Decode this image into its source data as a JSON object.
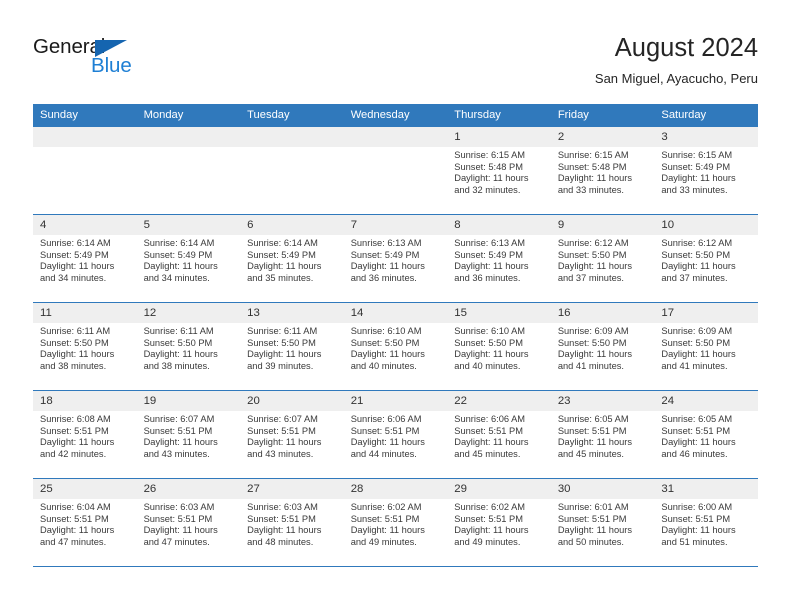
{
  "brand": {
    "name_part1": "General",
    "name_part2": "Blue",
    "accent_color": "#1e7fd4",
    "triangle_color": "#1565b0"
  },
  "header": {
    "title": "August 2024",
    "subtitle": "San Miguel, Ayacucho, Peru"
  },
  "theme": {
    "header_bg": "#3079bc",
    "daynum_bg": "#efefef",
    "border": "#3079bc"
  },
  "weekday_headers": [
    "Sunday",
    "Monday",
    "Tuesday",
    "Wednesday",
    "Thursday",
    "Friday",
    "Saturday"
  ],
  "weeks": [
    [
      {
        "day": "",
        "sunrise": "",
        "sunset": "",
        "daylight": "",
        "empty": true
      },
      {
        "day": "",
        "sunrise": "",
        "sunset": "",
        "daylight": "",
        "empty": true
      },
      {
        "day": "",
        "sunrise": "",
        "sunset": "",
        "daylight": "",
        "empty": true
      },
      {
        "day": "",
        "sunrise": "",
        "sunset": "",
        "daylight": "",
        "empty": true
      },
      {
        "day": "1",
        "sunrise": "Sunrise: 6:15 AM",
        "sunset": "Sunset: 5:48 PM",
        "daylight": "Daylight: 11 hours and 32 minutes."
      },
      {
        "day": "2",
        "sunrise": "Sunrise: 6:15 AM",
        "sunset": "Sunset: 5:48 PM",
        "daylight": "Daylight: 11 hours and 33 minutes."
      },
      {
        "day": "3",
        "sunrise": "Sunrise: 6:15 AM",
        "sunset": "Sunset: 5:49 PM",
        "daylight": "Daylight: 11 hours and 33 minutes."
      }
    ],
    [
      {
        "day": "4",
        "sunrise": "Sunrise: 6:14 AM",
        "sunset": "Sunset: 5:49 PM",
        "daylight": "Daylight: 11 hours and 34 minutes."
      },
      {
        "day": "5",
        "sunrise": "Sunrise: 6:14 AM",
        "sunset": "Sunset: 5:49 PM",
        "daylight": "Daylight: 11 hours and 34 minutes."
      },
      {
        "day": "6",
        "sunrise": "Sunrise: 6:14 AM",
        "sunset": "Sunset: 5:49 PM",
        "daylight": "Daylight: 11 hours and 35 minutes."
      },
      {
        "day": "7",
        "sunrise": "Sunrise: 6:13 AM",
        "sunset": "Sunset: 5:49 PM",
        "daylight": "Daylight: 11 hours and 36 minutes."
      },
      {
        "day": "8",
        "sunrise": "Sunrise: 6:13 AM",
        "sunset": "Sunset: 5:49 PM",
        "daylight": "Daylight: 11 hours and 36 minutes."
      },
      {
        "day": "9",
        "sunrise": "Sunrise: 6:12 AM",
        "sunset": "Sunset: 5:50 PM",
        "daylight": "Daylight: 11 hours and 37 minutes."
      },
      {
        "day": "10",
        "sunrise": "Sunrise: 6:12 AM",
        "sunset": "Sunset: 5:50 PM",
        "daylight": "Daylight: 11 hours and 37 minutes."
      }
    ],
    [
      {
        "day": "11",
        "sunrise": "Sunrise: 6:11 AM",
        "sunset": "Sunset: 5:50 PM",
        "daylight": "Daylight: 11 hours and 38 minutes."
      },
      {
        "day": "12",
        "sunrise": "Sunrise: 6:11 AM",
        "sunset": "Sunset: 5:50 PM",
        "daylight": "Daylight: 11 hours and 38 minutes."
      },
      {
        "day": "13",
        "sunrise": "Sunrise: 6:11 AM",
        "sunset": "Sunset: 5:50 PM",
        "daylight": "Daylight: 11 hours and 39 minutes."
      },
      {
        "day": "14",
        "sunrise": "Sunrise: 6:10 AM",
        "sunset": "Sunset: 5:50 PM",
        "daylight": "Daylight: 11 hours and 40 minutes."
      },
      {
        "day": "15",
        "sunrise": "Sunrise: 6:10 AM",
        "sunset": "Sunset: 5:50 PM",
        "daylight": "Daylight: 11 hours and 40 minutes."
      },
      {
        "day": "16",
        "sunrise": "Sunrise: 6:09 AM",
        "sunset": "Sunset: 5:50 PM",
        "daylight": "Daylight: 11 hours and 41 minutes."
      },
      {
        "day": "17",
        "sunrise": "Sunrise: 6:09 AM",
        "sunset": "Sunset: 5:50 PM",
        "daylight": "Daylight: 11 hours and 41 minutes."
      }
    ],
    [
      {
        "day": "18",
        "sunrise": "Sunrise: 6:08 AM",
        "sunset": "Sunset: 5:51 PM",
        "daylight": "Daylight: 11 hours and 42 minutes."
      },
      {
        "day": "19",
        "sunrise": "Sunrise: 6:07 AM",
        "sunset": "Sunset: 5:51 PM",
        "daylight": "Daylight: 11 hours and 43 minutes."
      },
      {
        "day": "20",
        "sunrise": "Sunrise: 6:07 AM",
        "sunset": "Sunset: 5:51 PM",
        "daylight": "Daylight: 11 hours and 43 minutes."
      },
      {
        "day": "21",
        "sunrise": "Sunrise: 6:06 AM",
        "sunset": "Sunset: 5:51 PM",
        "daylight": "Daylight: 11 hours and 44 minutes."
      },
      {
        "day": "22",
        "sunrise": "Sunrise: 6:06 AM",
        "sunset": "Sunset: 5:51 PM",
        "daylight": "Daylight: 11 hours and 45 minutes."
      },
      {
        "day": "23",
        "sunrise": "Sunrise: 6:05 AM",
        "sunset": "Sunset: 5:51 PM",
        "daylight": "Daylight: 11 hours and 45 minutes."
      },
      {
        "day": "24",
        "sunrise": "Sunrise: 6:05 AM",
        "sunset": "Sunset: 5:51 PM",
        "daylight": "Daylight: 11 hours and 46 minutes."
      }
    ],
    [
      {
        "day": "25",
        "sunrise": "Sunrise: 6:04 AM",
        "sunset": "Sunset: 5:51 PM",
        "daylight": "Daylight: 11 hours and 47 minutes."
      },
      {
        "day": "26",
        "sunrise": "Sunrise: 6:03 AM",
        "sunset": "Sunset: 5:51 PM",
        "daylight": "Daylight: 11 hours and 47 minutes."
      },
      {
        "day": "27",
        "sunrise": "Sunrise: 6:03 AM",
        "sunset": "Sunset: 5:51 PM",
        "daylight": "Daylight: 11 hours and 48 minutes."
      },
      {
        "day": "28",
        "sunrise": "Sunrise: 6:02 AM",
        "sunset": "Sunset: 5:51 PM",
        "daylight": "Daylight: 11 hours and 49 minutes."
      },
      {
        "day": "29",
        "sunrise": "Sunrise: 6:02 AM",
        "sunset": "Sunset: 5:51 PM",
        "daylight": "Daylight: 11 hours and 49 minutes."
      },
      {
        "day": "30",
        "sunrise": "Sunrise: 6:01 AM",
        "sunset": "Sunset: 5:51 PM",
        "daylight": "Daylight: 11 hours and 50 minutes."
      },
      {
        "day": "31",
        "sunrise": "Sunrise: 6:00 AM",
        "sunset": "Sunset: 5:51 PM",
        "daylight": "Daylight: 11 hours and 51 minutes."
      }
    ]
  ]
}
